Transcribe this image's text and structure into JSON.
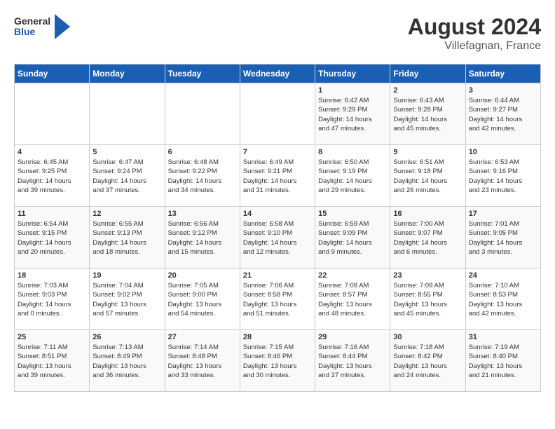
{
  "logo": {
    "general": "General",
    "blue": "Blue"
  },
  "title": "August 2024",
  "subtitle": "Villefagnan, France",
  "days_of_week": [
    "Sunday",
    "Monday",
    "Tuesday",
    "Wednesday",
    "Thursday",
    "Friday",
    "Saturday"
  ],
  "weeks": [
    [
      {
        "day": "",
        "info": ""
      },
      {
        "day": "",
        "info": ""
      },
      {
        "day": "",
        "info": ""
      },
      {
        "day": "",
        "info": ""
      },
      {
        "day": "1",
        "info": "Sunrise: 6:42 AM\nSunset: 9:29 PM\nDaylight: 14 hours\nand 47 minutes."
      },
      {
        "day": "2",
        "info": "Sunrise: 6:43 AM\nSunset: 9:28 PM\nDaylight: 14 hours\nand 45 minutes."
      },
      {
        "day": "3",
        "info": "Sunrise: 6:44 AM\nSunset: 9:27 PM\nDaylight: 14 hours\nand 42 minutes."
      }
    ],
    [
      {
        "day": "4",
        "info": "Sunrise: 6:45 AM\nSunset: 9:25 PM\nDaylight: 14 hours\nand 39 minutes."
      },
      {
        "day": "5",
        "info": "Sunrise: 6:47 AM\nSunset: 9:24 PM\nDaylight: 14 hours\nand 37 minutes."
      },
      {
        "day": "6",
        "info": "Sunrise: 6:48 AM\nSunset: 9:22 PM\nDaylight: 14 hours\nand 34 minutes."
      },
      {
        "day": "7",
        "info": "Sunrise: 6:49 AM\nSunset: 9:21 PM\nDaylight: 14 hours\nand 31 minutes."
      },
      {
        "day": "8",
        "info": "Sunrise: 6:50 AM\nSunset: 9:19 PM\nDaylight: 14 hours\nand 29 minutes."
      },
      {
        "day": "9",
        "info": "Sunrise: 6:51 AM\nSunset: 9:18 PM\nDaylight: 14 hours\nand 26 minutes."
      },
      {
        "day": "10",
        "info": "Sunrise: 6:53 AM\nSunset: 9:16 PM\nDaylight: 14 hours\nand 23 minutes."
      }
    ],
    [
      {
        "day": "11",
        "info": "Sunrise: 6:54 AM\nSunset: 9:15 PM\nDaylight: 14 hours\nand 20 minutes."
      },
      {
        "day": "12",
        "info": "Sunrise: 6:55 AM\nSunset: 9:13 PM\nDaylight: 14 hours\nand 18 minutes."
      },
      {
        "day": "13",
        "info": "Sunrise: 6:56 AM\nSunset: 9:12 PM\nDaylight: 14 hours\nand 15 minutes."
      },
      {
        "day": "14",
        "info": "Sunrise: 6:58 AM\nSunset: 9:10 PM\nDaylight: 14 hours\nand 12 minutes."
      },
      {
        "day": "15",
        "info": "Sunrise: 6:59 AM\nSunset: 9:09 PM\nDaylight: 14 hours\nand 9 minutes."
      },
      {
        "day": "16",
        "info": "Sunrise: 7:00 AM\nSunset: 9:07 PM\nDaylight: 14 hours\nand 6 minutes."
      },
      {
        "day": "17",
        "info": "Sunrise: 7:01 AM\nSunset: 9:05 PM\nDaylight: 14 hours\nand 3 minutes."
      }
    ],
    [
      {
        "day": "18",
        "info": "Sunrise: 7:03 AM\nSunset: 9:03 PM\nDaylight: 14 hours\nand 0 minutes."
      },
      {
        "day": "19",
        "info": "Sunrise: 7:04 AM\nSunset: 9:02 PM\nDaylight: 13 hours\nand 57 minutes."
      },
      {
        "day": "20",
        "info": "Sunrise: 7:05 AM\nSunset: 9:00 PM\nDaylight: 13 hours\nand 54 minutes."
      },
      {
        "day": "21",
        "info": "Sunrise: 7:06 AM\nSunset: 8:58 PM\nDaylight: 13 hours\nand 51 minutes."
      },
      {
        "day": "22",
        "info": "Sunrise: 7:08 AM\nSunset: 8:57 PM\nDaylight: 13 hours\nand 48 minutes."
      },
      {
        "day": "23",
        "info": "Sunrise: 7:09 AM\nSunset: 8:55 PM\nDaylight: 13 hours\nand 45 minutes."
      },
      {
        "day": "24",
        "info": "Sunrise: 7:10 AM\nSunset: 8:53 PM\nDaylight: 13 hours\nand 42 minutes."
      }
    ],
    [
      {
        "day": "25",
        "info": "Sunrise: 7:11 AM\nSunset: 8:51 PM\nDaylight: 13 hours\nand 39 minutes."
      },
      {
        "day": "26",
        "info": "Sunrise: 7:13 AM\nSunset: 8:49 PM\nDaylight: 13 hours\nand 36 minutes."
      },
      {
        "day": "27",
        "info": "Sunrise: 7:14 AM\nSunset: 8:48 PM\nDaylight: 13 hours\nand 33 minutes."
      },
      {
        "day": "28",
        "info": "Sunrise: 7:15 AM\nSunset: 8:46 PM\nDaylight: 13 hours\nand 30 minutes."
      },
      {
        "day": "29",
        "info": "Sunrise: 7:16 AM\nSunset: 8:44 PM\nDaylight: 13 hours\nand 27 minutes."
      },
      {
        "day": "30",
        "info": "Sunrise: 7:18 AM\nSunset: 8:42 PM\nDaylight: 13 hours\nand 24 minutes."
      },
      {
        "day": "31",
        "info": "Sunrise: 7:19 AM\nSunset: 8:40 PM\nDaylight: 13 hours\nand 21 minutes."
      }
    ]
  ]
}
